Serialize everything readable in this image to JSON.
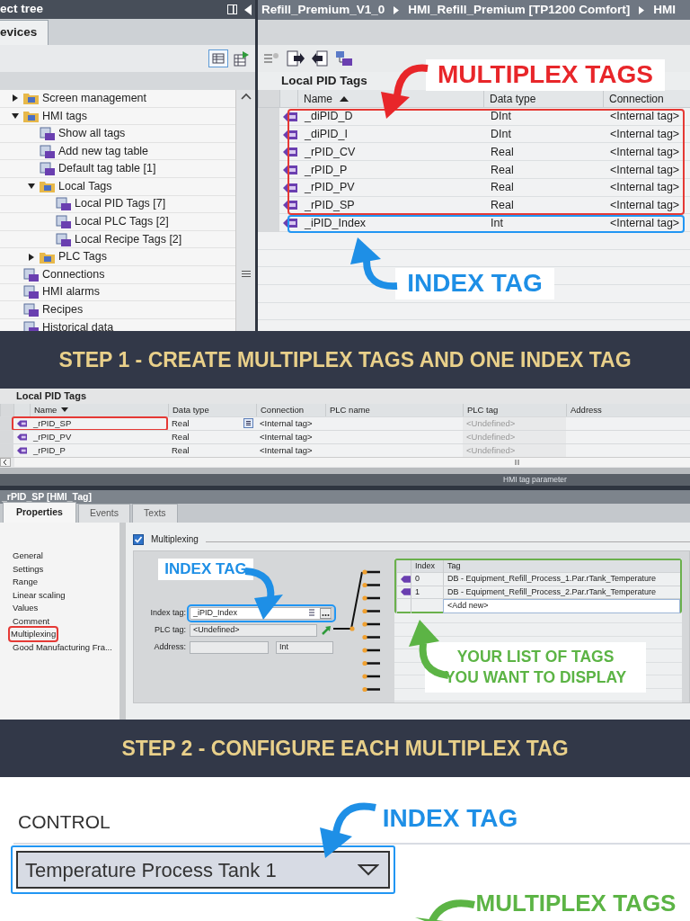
{
  "screen1": {
    "tree_title": "ect tree",
    "tree_tab": "evices",
    "tree": [
      {
        "label": "Screen management",
        "expanded": false
      },
      {
        "label": "HMI tags",
        "expanded": true,
        "children": [
          {
            "label": "Show all tags"
          },
          {
            "label": "Add new tag table"
          },
          {
            "label": "Default tag table [1]"
          },
          {
            "label": "Local Tags",
            "expanded": true,
            "children": [
              {
                "label": "Local PID Tags [7]"
              },
              {
                "label": "Local PLC Tags [2]"
              },
              {
                "label": "Local Recipe Tags [2]"
              }
            ]
          },
          {
            "label": "PLC Tags",
            "expanded": false
          }
        ]
      },
      {
        "label": "Connections"
      },
      {
        "label": "HMI alarms"
      },
      {
        "label": "Recipes"
      },
      {
        "label": "Historical data"
      }
    ],
    "breadcrumb": [
      "Refill_Premium_V1_0",
      "HMI_Refill_Premium [TP1200 Comfort]",
      "HMI"
    ],
    "table_title": "Local PID Tags",
    "columns": [
      "Name",
      "Data type",
      "Connection"
    ],
    "rows": [
      {
        "name": "_diPID_D",
        "data_type": "DInt",
        "connection": "<Internal tag>",
        "color": "#e53935"
      },
      {
        "name": "_diPID_I",
        "data_type": "DInt",
        "connection": "<Internal tag>",
        "color": "#e53935"
      },
      {
        "name": "_rPID_CV",
        "data_type": "Real",
        "connection": "<Internal tag>",
        "color": "#e53935"
      },
      {
        "name": "_rPID_P",
        "data_type": "Real",
        "connection": "<Internal tag>",
        "color": "#e53935"
      },
      {
        "name": "_rPID_PV",
        "data_type": "Real",
        "connection": "<Internal tag>",
        "color": "#e53935"
      },
      {
        "name": "_rPID_SP",
        "data_type": "Real",
        "connection": "<Internal tag>",
        "color": "#e53935"
      },
      {
        "name": "_iPID_Index",
        "data_type": "Int",
        "connection": "<Internal tag>",
        "color": "#2196f3"
      }
    ],
    "multiplex_callout": "MULTIPLEX TAGS",
    "index_callout": "INDEX TAG"
  },
  "step1": "STEP 1 - CREATE MULTIPLEX TAGS AND ONE INDEX TAG",
  "screen2": {
    "title": "Local PID Tags",
    "columns": [
      "Name",
      "Data type",
      "Connection",
      "PLC name",
      "PLC tag",
      "Address"
    ],
    "rows": [
      {
        "name": "_rPID_SP",
        "data_type": "Real",
        "connection": "<Internal tag>",
        "plc_tag": "<Undefined>",
        "selected": true
      },
      {
        "name": "_rPID_PV",
        "data_type": "Real",
        "connection": "<Internal tag>",
        "plc_tag": "<Undefined>",
        "selected": false
      },
      {
        "name": "_rPID_P",
        "data_type": "Real",
        "connection": "<Internal tag>",
        "plc_tag": "<Undefined>",
        "selected": false
      }
    ],
    "footer": "HMI tag parameter"
  },
  "screen3": {
    "title": "_rPID_SP [HMI_Tag]",
    "tabs": [
      {
        "label": "Properties",
        "selected": true
      },
      {
        "label": "Events",
        "selected": false
      },
      {
        "label": "Texts",
        "selected": false
      }
    ],
    "nav": [
      {
        "label": "General",
        "selected": false
      },
      {
        "label": "Settings",
        "selected": false
      },
      {
        "label": "Range",
        "selected": false
      },
      {
        "label": "Linear scaling",
        "selected": false
      },
      {
        "label": "Values",
        "selected": false
      },
      {
        "label": "Comment",
        "selected": false
      },
      {
        "label": "Multiplexing",
        "selected": true
      },
      {
        "label": "Good Manufacturing Fra...",
        "selected": false
      }
    ],
    "multiplexing": {
      "label": "Multiplexing",
      "checked": true
    },
    "fields": [
      {
        "label": "Index tag:",
        "value": "_iPID_Index",
        "kind": "picker",
        "highlighted": true
      },
      {
        "label": "PLC tag:",
        "value": "<Undefined>",
        "kind": "link",
        "highlighted": false
      },
      {
        "label": "Address:",
        "type": "Int",
        "kind": "address",
        "highlighted": false
      }
    ],
    "tag_list": {
      "columns": [
        "Index",
        "Tag"
      ],
      "rows": [
        {
          "index": "0",
          "tag": "DB - Equipment_Refill_Process_1.Par.rTank_Temperature"
        },
        {
          "index": "1",
          "tag": "DB - Equipment_Refill_Process_2.Par.rTank_Temperature"
        }
      ],
      "add_new": "<Add new>"
    },
    "index_callout": "INDEX TAG",
    "list_callout": [
      "YOUR LIST OF TAGS",
      "YOU WANT TO DISPLAY"
    ]
  },
  "step2": "STEP 2 - CONFIGURE EACH MULTIPLEX TAG",
  "control": {
    "label": "CONTROL",
    "dropdown": {
      "value": "Temperature Process Tank 1"
    },
    "index_callout": "INDEX TAG",
    "multiplex_callout": "MULTIPLEX TAGS"
  }
}
